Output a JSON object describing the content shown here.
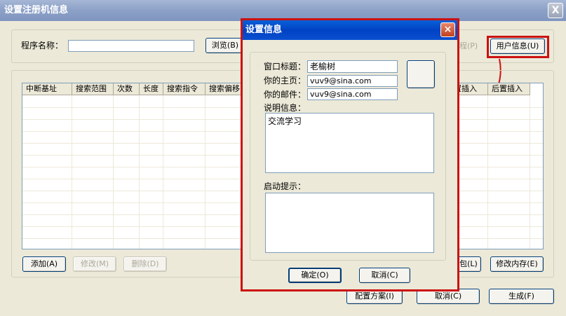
{
  "main": {
    "title": "设置注册机信息",
    "close": "X",
    "program_label": "程序名称：",
    "program_value": "",
    "browse_label": "浏览(B)",
    "process_label": "程(P)",
    "user_info_label": "用户信息(U)",
    "columns": [
      "中断基址",
      "搜索范围",
      "次数",
      "长度",
      "搜索指令",
      "搜索偏移",
      "置插入",
      "后置插入"
    ],
    "add_label": "添加(A)",
    "modify_label": "修改(M)",
    "delete_label": "删除(D)",
    "mem_partial_label": "包(L)",
    "modify_mem_label": "修改内存(E)",
    "config_label": "配置方案(I)",
    "cancel_label": "取消(C)",
    "generate_label": "生成(F)"
  },
  "dialog": {
    "title": "设置信息",
    "close": "×",
    "window_title_label": "窗口标题：",
    "window_title_value": "老榆树",
    "homepage_label": "你的主页：",
    "homepage_value": "vuv9@sina.com",
    "email_label": "你的邮件：",
    "email_value": "vuv9@sina.com",
    "desc_label": "说明信息：",
    "desc_value": "交流学习",
    "startup_label": "启动提示：",
    "startup_value": "",
    "ok_label": "确定(O)",
    "cancel_label": "取消(C)"
  },
  "colors": {
    "highlight": "#cc1111",
    "active_title": "#0042c4",
    "inactive_title": "#8ea2c8"
  }
}
